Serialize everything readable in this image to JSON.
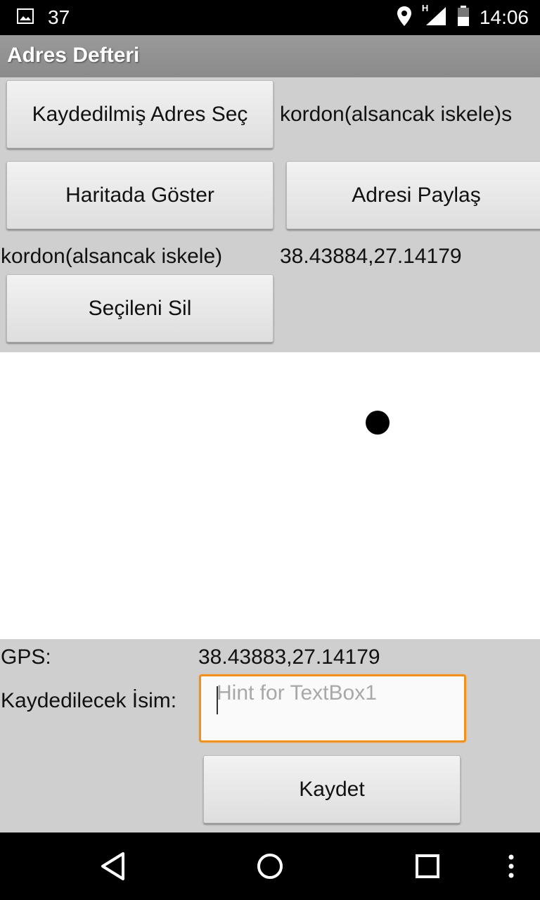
{
  "status_bar": {
    "notification_count": "37",
    "time": "14:06",
    "network_type": "H",
    "icons": [
      "image-icon",
      "location-icon",
      "signal-icon",
      "battery-icon"
    ]
  },
  "app": {
    "title": "Adres Defteri"
  },
  "top_section": {
    "select_saved_button": "Kaydedilmiş Adres Seç",
    "selected_address_label": "kordon(alsancak iskele)s",
    "show_on_map_button": "Haritada Göster",
    "share_address_button": "Adresi Paylaş",
    "address_name": "kordon(alsancak iskele)",
    "address_coords": "38.43884,27.14179",
    "delete_selected_button": "Seçileni Sil"
  },
  "bottom_section": {
    "gps_label": "GPS:",
    "gps_value": "38.43883,27.14179",
    "name_label": "Kaydedilecek İsim:",
    "name_input_value": "",
    "name_input_placeholder": "Hint for TextBox1",
    "save_button": "Kaydet"
  },
  "navigation": {
    "icons": [
      "back-icon",
      "home-icon",
      "recents-icon",
      "menu-icon"
    ]
  },
  "colors": {
    "accent_focus": "#f0901e",
    "background": "#cfcfcf",
    "titlebar": "#8f8f8f"
  }
}
